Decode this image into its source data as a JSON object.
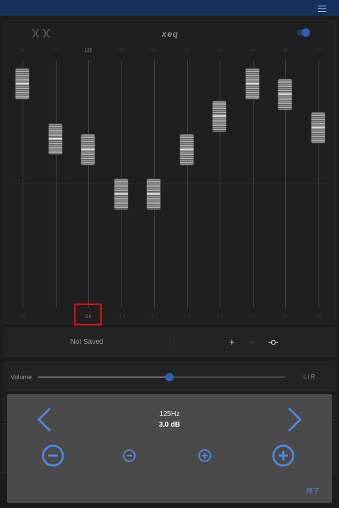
{
  "app": {
    "brand": "xeq",
    "accent_color": "#2f5fb0",
    "top_bar_color": "#17315f"
  },
  "equalizer": {
    "selected_band": 2,
    "bands": [
      {
        "freq": "31",
        "value": "9.0",
        "gain": 9
      },
      {
        "freq": "62",
        "value": "4.0",
        "gain": 4
      },
      {
        "freq": "125",
        "value": "3.0",
        "gain": 3
      },
      {
        "freq": "250",
        "value": "-1.0",
        "gain": -1
      },
      {
        "freq": "500",
        "value": "-1.0",
        "gain": -1
      },
      {
        "freq": "1k",
        "value": "3.0",
        "gain": 3
      },
      {
        "freq": "2k",
        "value": "6.0",
        "gain": 6
      },
      {
        "freq": "4k",
        "value": "9.0",
        "gain": 9
      },
      {
        "freq": "8k",
        "value": "8.0",
        "gain": 8
      },
      {
        "freq": "16k",
        "value": "5.0",
        "gain": 5
      }
    ]
  },
  "preset": {
    "name": "Not Saved",
    "add_label": "+",
    "remove_label": "−"
  },
  "volume": {
    "label": "Volume",
    "level_fraction": 0.53,
    "balance_label": "L | R"
  },
  "popup": {
    "frequency": "125Hz",
    "gain": "3.0 dB",
    "done_label": "終了"
  }
}
